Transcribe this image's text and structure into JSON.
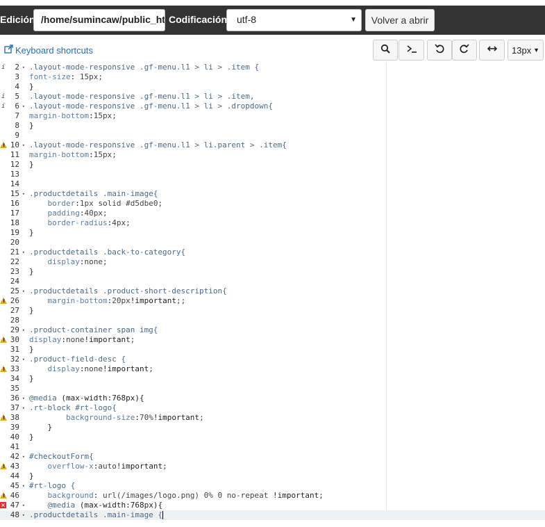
{
  "toolbar": {
    "edit_label": "Edición:",
    "path_value": "/home/sumincaw/public_html/templates/rt_chapelco/css-compiled/menu-responsive.css",
    "encoding_label": "Codificación:",
    "encoding_value": "utf-8",
    "reopen_label": "Volver a abrir"
  },
  "subtoolbar": {
    "shortcuts_label": "Keyboard shortcuts",
    "font_size": "13px",
    "buttons": [
      "search-icon",
      "terminal-icon",
      "undo-icon",
      "redo-icon",
      "wrap-icon"
    ]
  },
  "editor": {
    "lines": [
      {
        "n": "2",
        "fold": "▾",
        "mark": "info",
        "text": ".layout-mode-responsive .gf-menu.l1 > li > .item {"
      },
      {
        "n": "3",
        "fold": "",
        "mark": "",
        "text": "font-size: 15px;"
      },
      {
        "n": "4",
        "fold": "",
        "mark": "",
        "text": "}"
      },
      {
        "n": "5",
        "fold": "",
        "mark": "info",
        "text": ".layout-mode-responsive .gf-menu.l1 > li > .item,"
      },
      {
        "n": "6",
        "fold": "▾",
        "mark": "info",
        "text": ".layout-mode-responsive .gf-menu.l1 > li > .dropdown{"
      },
      {
        "n": "7",
        "fold": "",
        "mark": "",
        "text": "margin-bottom:15px;"
      },
      {
        "n": "8",
        "fold": "",
        "mark": "",
        "text": "}"
      },
      {
        "n": "9",
        "fold": "",
        "mark": "",
        "text": ""
      },
      {
        "n": "10",
        "fold": "▾",
        "mark": "warn",
        "text": ".layout-mode-responsive .gf-menu.l1 > li.parent > .item{"
      },
      {
        "n": "11",
        "fold": "",
        "mark": "",
        "text": "margin-bottom:15px;"
      },
      {
        "n": "12",
        "fold": "",
        "mark": "",
        "text": "}"
      },
      {
        "n": "13",
        "fold": "",
        "mark": "",
        "text": ""
      },
      {
        "n": "14",
        "fold": "",
        "mark": "",
        "text": ""
      },
      {
        "n": "15",
        "fold": "▾",
        "mark": "",
        "text": ".productdetails .main-image{"
      },
      {
        "n": "16",
        "fold": "",
        "mark": "",
        "text": "    border:1px solid #d5dbe0;"
      },
      {
        "n": "17",
        "fold": "",
        "mark": "",
        "text": "    padding:40px;"
      },
      {
        "n": "18",
        "fold": "",
        "mark": "",
        "text": "    border-radius:4px;"
      },
      {
        "n": "19",
        "fold": "",
        "mark": "",
        "text": "}"
      },
      {
        "n": "20",
        "fold": "",
        "mark": "",
        "text": ""
      },
      {
        "n": "21",
        "fold": "▾",
        "mark": "",
        "text": ".productdetails .back-to-category{"
      },
      {
        "n": "22",
        "fold": "",
        "mark": "",
        "text": "    display:none;"
      },
      {
        "n": "23",
        "fold": "",
        "mark": "",
        "text": "}"
      },
      {
        "n": "24",
        "fold": "",
        "mark": "",
        "text": ""
      },
      {
        "n": "25",
        "fold": "▾",
        "mark": "",
        "text": ".productdetails .product-short-description{"
      },
      {
        "n": "26",
        "fold": "",
        "mark": "warn",
        "text": "    margin-bottom:20px!important;;"
      },
      {
        "n": "27",
        "fold": "",
        "mark": "",
        "text": "}"
      },
      {
        "n": "28",
        "fold": "",
        "mark": "",
        "text": ""
      },
      {
        "n": "29",
        "fold": "▾",
        "mark": "",
        "text": ".product-container span img{"
      },
      {
        "n": "30",
        "fold": "",
        "mark": "warn",
        "text": "display:none!important;"
      },
      {
        "n": "31",
        "fold": "",
        "mark": "",
        "text": "}"
      },
      {
        "n": "32",
        "fold": "▾",
        "mark": "",
        "text": ".product-field-desc {"
      },
      {
        "n": "33",
        "fold": "",
        "mark": "warn",
        "text": "    display:none!important;"
      },
      {
        "n": "34",
        "fold": "",
        "mark": "",
        "text": "}"
      },
      {
        "n": "35",
        "fold": "",
        "mark": "",
        "text": ""
      },
      {
        "n": "36",
        "fold": "▾",
        "mark": "",
        "text": "@media (max-width:768px){"
      },
      {
        "n": "37",
        "fold": "▾",
        "mark": "",
        "text": ".rt-block #rt-logo{"
      },
      {
        "n": "38",
        "fold": "",
        "mark": "warn",
        "text": "        background-size:70%!important;"
      },
      {
        "n": "39",
        "fold": "",
        "mark": "",
        "text": "    }"
      },
      {
        "n": "40",
        "fold": "",
        "mark": "",
        "text": "}"
      },
      {
        "n": "41",
        "fold": "",
        "mark": "",
        "text": ""
      },
      {
        "n": "42",
        "fold": "▾",
        "mark": "",
        "text": "#checkoutForm{"
      },
      {
        "n": "43",
        "fold": "",
        "mark": "warn",
        "text": "    overflow-x:auto!important;"
      },
      {
        "n": "44",
        "fold": "",
        "mark": "",
        "text": "}"
      },
      {
        "n": "45",
        "fold": "▾",
        "mark": "",
        "text": "#rt-logo {"
      },
      {
        "n": "46",
        "fold": "",
        "mark": "warn",
        "text": "    background: url(/images/logo.png) 0% 0 no-repeat !important;"
      },
      {
        "n": "47",
        "fold": "▾",
        "mark": "err",
        "text": "    @media (max-width:768px){"
      },
      {
        "n": "48",
        "fold": "▾",
        "mark": "",
        "text": ".productdetails .main-image {"
      }
    ]
  },
  "colors": {
    "topbar_bg": "#333333",
    "link": "#2a6fb0",
    "selector": "#4a6a8a",
    "property": "#5b7ea6",
    "value": "#444444",
    "warning": "#e6a817",
    "error": "#d9302c"
  }
}
